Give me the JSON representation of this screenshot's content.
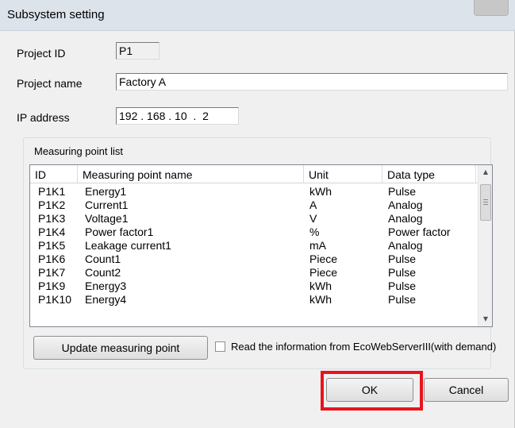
{
  "window": {
    "title": "Subsystem setting"
  },
  "form": {
    "project_id": {
      "label": "Project ID",
      "value": "P1"
    },
    "project_name": {
      "label": "Project name",
      "value": "Factory A"
    },
    "ip_address": {
      "label": "IP address",
      "value": "192 . 168 . 10  .  2"
    }
  },
  "measuring_point_list": {
    "title": "Measuring point list",
    "columns": [
      "ID",
      "Measuring point name",
      "Unit",
      "Data type"
    ],
    "rows": [
      {
        "id": "P1K1",
        "name": "Energy1",
        "unit": "kWh",
        "type": "Pulse"
      },
      {
        "id": "P1K2",
        "name": "Current1",
        "unit": "A",
        "type": "Analog"
      },
      {
        "id": "P1K3",
        "name": "Voltage1",
        "unit": "V",
        "type": "Analog"
      },
      {
        "id": "P1K4",
        "name": "Power factor1",
        "unit": "%",
        "type": "Power factor"
      },
      {
        "id": "P1K5",
        "name": "Leakage current1",
        "unit": "mA",
        "type": "Analog"
      },
      {
        "id": "P1K6",
        "name": "Count1",
        "unit": "Piece",
        "type": "Pulse"
      },
      {
        "id": "P1K7",
        "name": "Count2",
        "unit": "Piece",
        "type": "Pulse"
      },
      {
        "id": "P1K9",
        "name": "Energy3",
        "unit": "kWh",
        "type": "Pulse"
      },
      {
        "id": "P1K10",
        "name": "Energy4",
        "unit": "kWh",
        "type": "Pulse"
      }
    ]
  },
  "actions": {
    "update_label": "Update measuring point",
    "read_info_label": "Read the information from EcoWebServerIII(with demand)",
    "read_info_checked": false,
    "ok_label": "OK",
    "cancel_label": "Cancel"
  },
  "icons": {
    "scroll_up": "scroll-up-arrow",
    "scroll_down": "scroll-down-arrow",
    "close": "close-button"
  },
  "colors": {
    "highlight": "#e8141b",
    "titlebar": "#dde3ea",
    "dialog_bg": "#f0f0f0"
  }
}
